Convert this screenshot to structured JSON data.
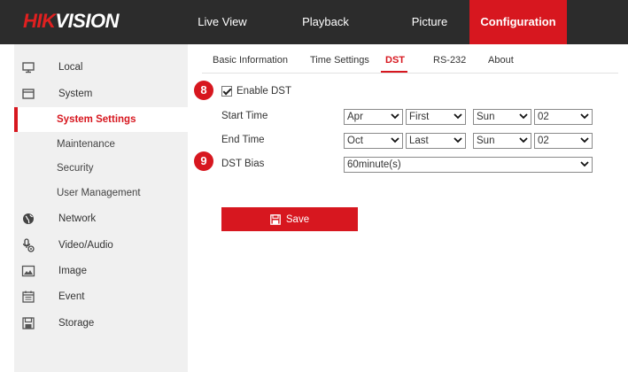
{
  "header": {
    "logo": {
      "part1": "HIK",
      "part2": "VISION"
    },
    "nav": [
      {
        "label": "Live View"
      },
      {
        "label": "Playback"
      },
      {
        "label": "Picture"
      },
      {
        "label": "Configuration",
        "active": true
      }
    ]
  },
  "sidebar": {
    "items": [
      {
        "label": "Local",
        "icon": "monitor-icon"
      },
      {
        "label": "System",
        "icon": "system-icon"
      },
      {
        "label": "System Settings",
        "active": true
      },
      {
        "label": "Maintenance"
      },
      {
        "label": "Security"
      },
      {
        "label": "User Management"
      },
      {
        "label": "Network",
        "icon": "globe-icon"
      },
      {
        "label": "Video/Audio",
        "icon": "video-audio-icon"
      },
      {
        "label": "Image",
        "icon": "image-icon"
      },
      {
        "label": "Event",
        "icon": "calendar-icon"
      },
      {
        "label": "Storage",
        "icon": "storage-icon"
      }
    ]
  },
  "tabs": [
    {
      "label": "Basic Information"
    },
    {
      "label": "Time Settings"
    },
    {
      "label": "DST",
      "active": true
    },
    {
      "label": "RS-232"
    },
    {
      "label": "About"
    }
  ],
  "form": {
    "badges": {
      "enable": "8",
      "bias": "9"
    },
    "enable_dst": {
      "label": "Enable DST",
      "checked": true
    },
    "start_time": {
      "label": "Start Time",
      "month": "Apr",
      "week": "First",
      "day": "Sun",
      "hour": "02"
    },
    "end_time": {
      "label": "End Time",
      "month": "Oct",
      "week": "Last",
      "day": "Sun",
      "hour": "02"
    },
    "dst_bias": {
      "label": "DST Bias",
      "value": "60minute(s)"
    },
    "save_label": "Save"
  },
  "colors": {
    "accent": "#d7171f",
    "header_bg": "#2c2c2c",
    "sidebar_bg": "#f0f0f0"
  }
}
